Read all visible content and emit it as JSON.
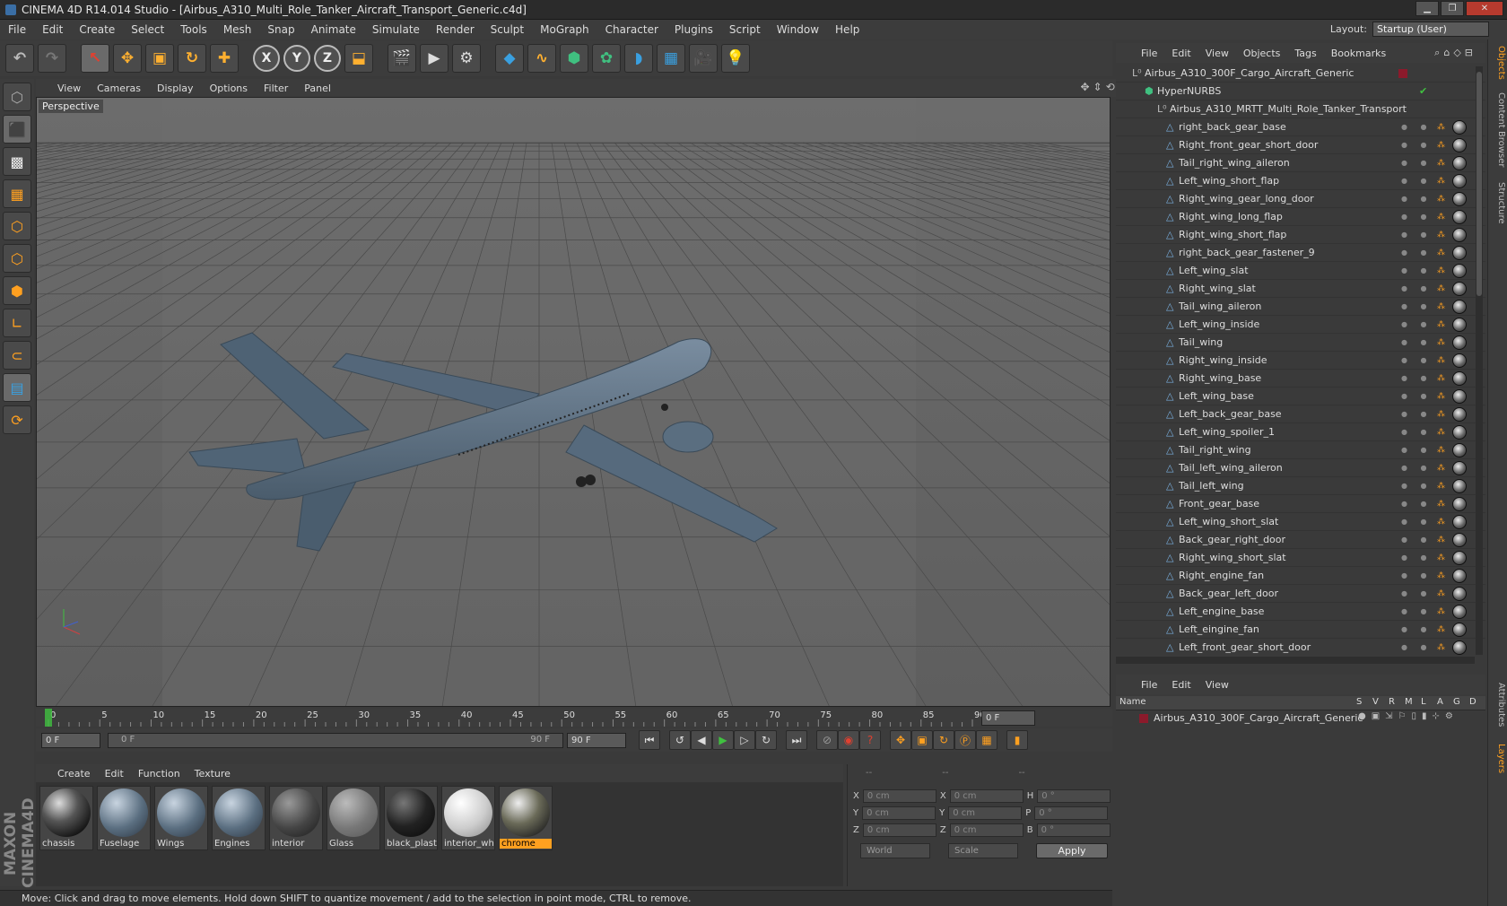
{
  "window": {
    "title": "CINEMA 4D R14.014 Studio - [Airbus_A310_Multi_Role_Tanker_Aircraft_Transport_Generic.c4d]",
    "min": "▁",
    "restore": "❐",
    "close": "✕"
  },
  "menubar": {
    "items": [
      "File",
      "Edit",
      "Create",
      "Select",
      "Tools",
      "Mesh",
      "Snap",
      "Animate",
      "Simulate",
      "Render",
      "Sculpt",
      "MoGraph",
      "Character",
      "Plugins",
      "Script",
      "Window",
      "Help"
    ],
    "layout_label": "Layout:",
    "layout_value": "Startup (User)"
  },
  "viewport": {
    "menu": [
      "View",
      "Cameras",
      "Display",
      "Options",
      "Filter",
      "Panel"
    ],
    "label": "Perspective"
  },
  "timeline": {
    "ticks": [
      "0",
      "5",
      "10",
      "15",
      "20",
      "25",
      "30",
      "35",
      "40",
      "45",
      "50",
      "55",
      "60",
      "65",
      "70",
      "75",
      "80",
      "85",
      "90"
    ],
    "current_frame": "0 F",
    "start_field": "0 F",
    "range_start": "0 F",
    "range_end": "90 F",
    "end_field": "90 F"
  },
  "material_manager": {
    "menu": [
      "Create",
      "Edit",
      "Function",
      "Texture"
    ],
    "materials": [
      {
        "name": "chassis",
        "style": "chrome-dark"
      },
      {
        "name": "Fuselage",
        "style": "bluegray"
      },
      {
        "name": "Wings",
        "style": "bluegray"
      },
      {
        "name": "Engines",
        "style": "bluegray"
      },
      {
        "name": "interior",
        "style": "darkgray"
      },
      {
        "name": "Glass",
        "style": "glass"
      },
      {
        "name": "black_plast",
        "style": "black"
      },
      {
        "name": "interior_wh",
        "style": "white"
      },
      {
        "name": "chrome",
        "style": "chrome",
        "active": true
      }
    ]
  },
  "coordinates": {
    "headers": [
      "--",
      "--",
      "--"
    ],
    "rows": [
      {
        "a": "X",
        "av": "0 cm",
        "b": "X",
        "bv": "0 cm",
        "c": "H",
        "cv": "0 °"
      },
      {
        "a": "Y",
        "av": "0 cm",
        "b": "Y",
        "bv": "0 cm",
        "c": "P",
        "cv": "0 °"
      },
      {
        "a": "Z",
        "av": "0 cm",
        "b": "Z",
        "bv": "0 cm",
        "c": "B",
        "cv": "0 °"
      }
    ],
    "space": "World",
    "mode": "Scale",
    "apply": "Apply"
  },
  "status": "Move: Click and drag to move elements. Hold down SHIFT to quantize movement / add to the selection in point mode, CTRL to remove.",
  "object_manager": {
    "menu": [
      "File",
      "Edit",
      "View",
      "Objects",
      "Tags",
      "Bookmarks"
    ],
    "root": "Airbus_A310_300F_Cargo_Aircraft_Generic",
    "hypernurbs": "HyperNURBS",
    "group": "Airbus_A310_MRTT_Multi_Role_Tanker_Transport",
    "children": [
      "right_back_gear_base",
      "Right_front_gear_short_door",
      "Tail_right_wing_aileron",
      "Left_wing_short_flap",
      "Right_wing_gear_long_door",
      "Right_wing_long_flap",
      "Right_wing_short_flap",
      "right_back_gear_fastener_9",
      "Left_wing_slat",
      "Right_wing_slat",
      "Tail_wing_aileron",
      "Left_wing_inside",
      "Tail_wing",
      "Right_wing_inside",
      "Right_wing_base",
      "Left_wing_base",
      "Left_back_gear_base",
      "Left_wing_spoiler_1",
      "Tail_right_wing",
      "Tail_left_wing_aileron",
      "Tail_left_wing",
      "Front_gear_base",
      "Left_wing_short_slat",
      "Back_gear_right_door",
      "Right_wing_short_slat",
      "Right_engine_fan",
      "Back_gear_left_door",
      "Left_engine_base",
      "Left_eingine_fan",
      "Left_front_gear_short_door"
    ]
  },
  "layer_manager": {
    "menu": [
      "File",
      "Edit",
      "View"
    ],
    "columns": [
      "Name",
      "S",
      "V",
      "R",
      "M",
      "L",
      "A",
      "G",
      "D"
    ],
    "layer": "Airbus_A310_300F_Cargo_Aircraft_Generic",
    "layer_color": "#8b1a2b"
  },
  "side_tabs": [
    "Objects",
    "Content Browser",
    "Structure",
    "Attributes",
    "Layers"
  ],
  "colors": {
    "accent": "#ffa020",
    "aircraft": "#5a6e80",
    "viewport_bg": "#6b6b6b"
  }
}
